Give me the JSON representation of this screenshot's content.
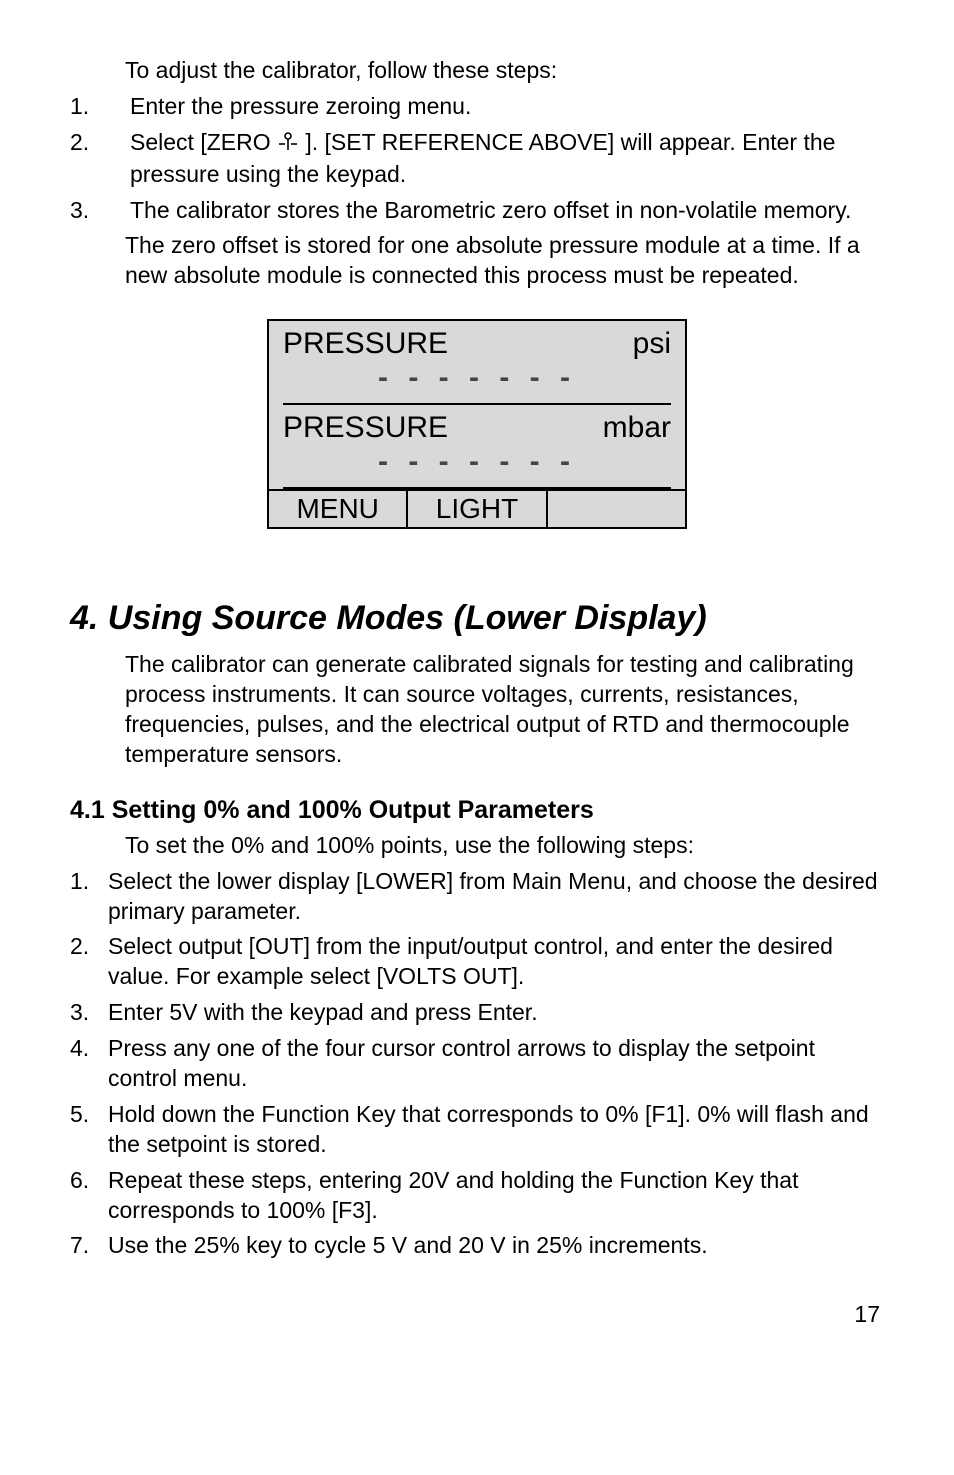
{
  "intro": {
    "lead": "To adjust the calibrator, follow these steps:",
    "steps": [
      {
        "n": "1.",
        "text": "Enter the pressure zeroing menu."
      },
      {
        "n": "2.",
        "prefix": "Select [ZERO ",
        "suffix": " ]. [SET REFERENCE ABOVE] will appear.  Enter      the pressure using the keypad."
      },
      {
        "n": "3.",
        "text": "The calibrator stores the Barometric zero offset in non-volatile memory."
      }
    ],
    "tail": "The zero offset is stored for one absolute pressure module at a time. If a new absolute module is connected this process must be repeated."
  },
  "lcd": {
    "top_label": "PRESSURE",
    "top_unit": "psi",
    "dashes": "- - - - - - -",
    "bot_label": "PRESSURE",
    "bot_unit": "mbar",
    "sk1": "MENU",
    "sk2": "LIGHT",
    "sk3": ""
  },
  "section": {
    "title": "4. Using Source Modes (Lower Display)",
    "body": "The calibrator can generate calibrated signals for testing and calibrating process instruments. It can source voltages, currents, resistances, frequencies, pulses, and the electrical output of RTD and thermocouple temperature sensors."
  },
  "subsection": {
    "title": "4.1 Setting 0% and 100% Output Parameters",
    "lead": "To set the 0% and 100% points, use the following steps:",
    "steps": [
      {
        "n": "1.",
        "text": "Select the lower display [LOWER] from Main Menu, and choose the desired primary parameter."
      },
      {
        "n": "2.",
        "text": "Select output [OUT] from the input/output control, and enter the desired value. For example select [VOLTS OUT]."
      },
      {
        "n": "3.",
        "text": "Enter 5V with the keypad and press Enter."
      },
      {
        "n": "4.",
        "text": "Press any one of the four cursor control arrows to display the setpoint control menu."
      },
      {
        "n": "5.",
        "text": "Hold down the Function Key that corresponds to 0% [F1]. 0% will flash and the setpoint is stored."
      },
      {
        "n": "6.",
        "text": "Repeat these steps, entering 20V and holding the Function Key that corresponds to 100% [F3]."
      },
      {
        "n": "7.",
        "text": "Use the 25% key to cycle 5 V and 20 V in 25% increments."
      }
    ]
  },
  "page_number": "17"
}
